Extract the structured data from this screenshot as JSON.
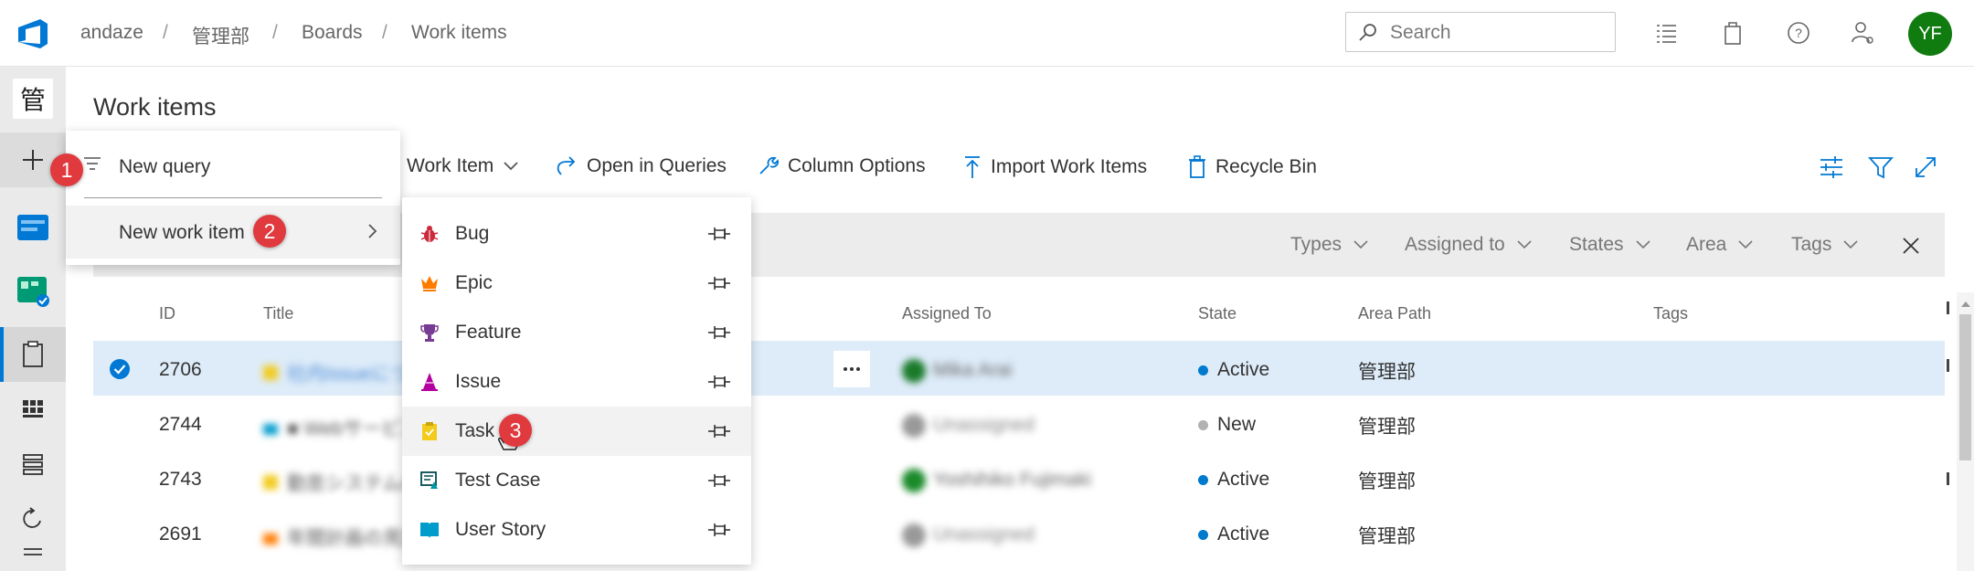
{
  "breadcrumb": {
    "org": "andaze",
    "project": "管理部",
    "section": "Boards",
    "page": "Work items",
    "sep": "/"
  },
  "search": {
    "placeholder": "Search"
  },
  "user": {
    "initials": "YF"
  },
  "project_badge": "管",
  "page_title": "Work items",
  "toolbar": {
    "work_item": "Work Item",
    "open_in_queries": "Open in Queries",
    "column_options": "Column Options",
    "import": "Import Work Items",
    "recycle_bin": "Recycle Bin"
  },
  "filters": [
    "Types",
    "Assigned to",
    "States",
    "Area",
    "Tags"
  ],
  "columns": {
    "id": "ID",
    "title": "Title",
    "assigned": "Assigned To",
    "state": "State",
    "area": "Area Path",
    "tags": "Tags"
  },
  "rows": [
    {
      "id": "2706",
      "title": "社内Issueについて",
      "assigned": "Mika Arai",
      "state": "Active",
      "area": "管理部",
      "selected": true
    },
    {
      "id": "2744",
      "title": "■ WebサービスID",
      "assigned": "Unassigned",
      "state": "New",
      "area": "管理部",
      "selected": false
    },
    {
      "id": "2743",
      "title": "勤怠システムの確認",
      "assigned": "Yoshihiko Fujimaki",
      "state": "Active",
      "area": "管理部",
      "selected": false
    },
    {
      "id": "2691",
      "title": "年間計画の見直し",
      "assigned": "Unassigned",
      "state": "Active",
      "area": "管理部",
      "selected": false
    }
  ],
  "new_menu": {
    "new_query": "New query",
    "new_work_item": "New work item"
  },
  "work_item_types": [
    {
      "label": "Bug",
      "icon": "bug-icon",
      "color": "#cc293d"
    },
    {
      "label": "Epic",
      "icon": "crown-icon",
      "color": "#ff7b00"
    },
    {
      "label": "Feature",
      "icon": "trophy-icon",
      "color": "#773b93"
    },
    {
      "label": "Issue",
      "icon": "issue-icon",
      "color": "#b4009e"
    },
    {
      "label": "Task",
      "icon": "task-clipboard-icon",
      "color": "#f2cb1d"
    },
    {
      "label": "Test Case",
      "icon": "test-case-icon",
      "color": "#004b50"
    },
    {
      "label": "User Story",
      "icon": "book-icon",
      "color": "#009ccc"
    }
  ],
  "steps": [
    "1",
    "2",
    "3"
  ],
  "colors": {
    "accent": "#0078d4",
    "active": "#007acc",
    "new": "#b2b2b2",
    "badge": "#e0393e",
    "selected_row": "#deecf9"
  }
}
